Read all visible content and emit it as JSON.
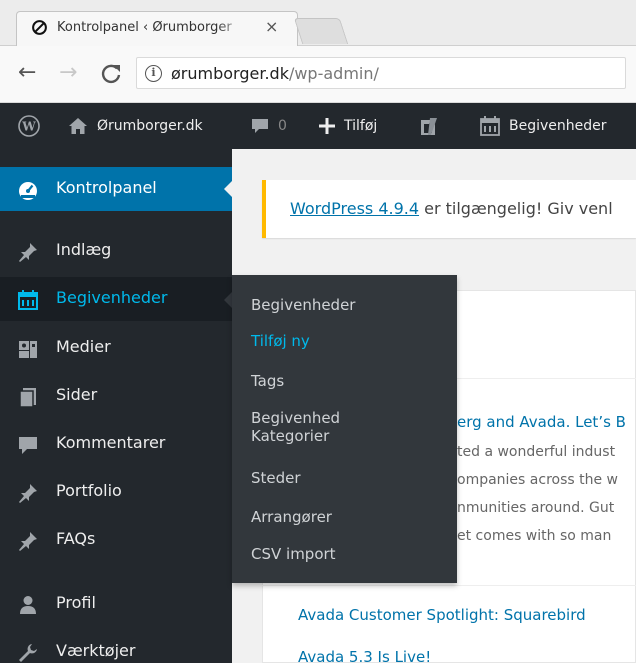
{
  "browser": {
    "tab_title": "Kontrolpanel ‹ Ørumborger",
    "tab_close": "×",
    "url_host": "ørumborger.dk",
    "url_path": "/wp-admin/",
    "info_glyph": "i"
  },
  "adminbar": {
    "site_name": "Ørumborger.dk",
    "comments_count": "0",
    "add_label": "Tilføj",
    "events_label": "Begivenheder"
  },
  "sidebar": {
    "items": [
      {
        "label": "Kontrolpanel",
        "icon": "dashboard-icon"
      },
      {
        "label": "Indlæg",
        "icon": "pin-icon"
      },
      {
        "label": "Begivenheder",
        "icon": "calendar-icon"
      },
      {
        "label": "Medier",
        "icon": "media-icon"
      },
      {
        "label": "Sider",
        "icon": "page-icon"
      },
      {
        "label": "Kommentarer",
        "icon": "comment-icon"
      },
      {
        "label": "Portfolio",
        "icon": "pin-icon"
      },
      {
        "label": "FAQs",
        "icon": "pin-icon"
      },
      {
        "label": "Profil",
        "icon": "user-icon"
      },
      {
        "label": "Værktøjer",
        "icon": "wrench-icon"
      }
    ]
  },
  "flyout": {
    "items": [
      {
        "label": "Begivenheder"
      },
      {
        "label": "Tilføj ny"
      },
      {
        "label": "Tags"
      },
      {
        "label": "Begivenhed Kategorier"
      },
      {
        "label": "Steder"
      },
      {
        "label": "Arrangører"
      },
      {
        "label": "CSV import"
      }
    ]
  },
  "notice": {
    "link": "WordPress 4.9.4",
    "text": " er tilgængelig! Giv venl"
  },
  "news": {
    "title": "erg and Avada. Let’s B",
    "lines": [
      "ted a wonderful indust",
      "ompanies across the w",
      "nmunities around. Gut",
      "et comes with so man"
    ],
    "rss": [
      "Avada Customer Spotlight: Squarebird",
      "Avada 5.3 Is Live!"
    ]
  },
  "colors": {
    "adminbar": "#23282d",
    "current": "#0073aa",
    "hover_text": "#00b9eb",
    "flyout_bg": "#32373c",
    "notice_border": "#ffb900",
    "link": "#0073aa"
  }
}
